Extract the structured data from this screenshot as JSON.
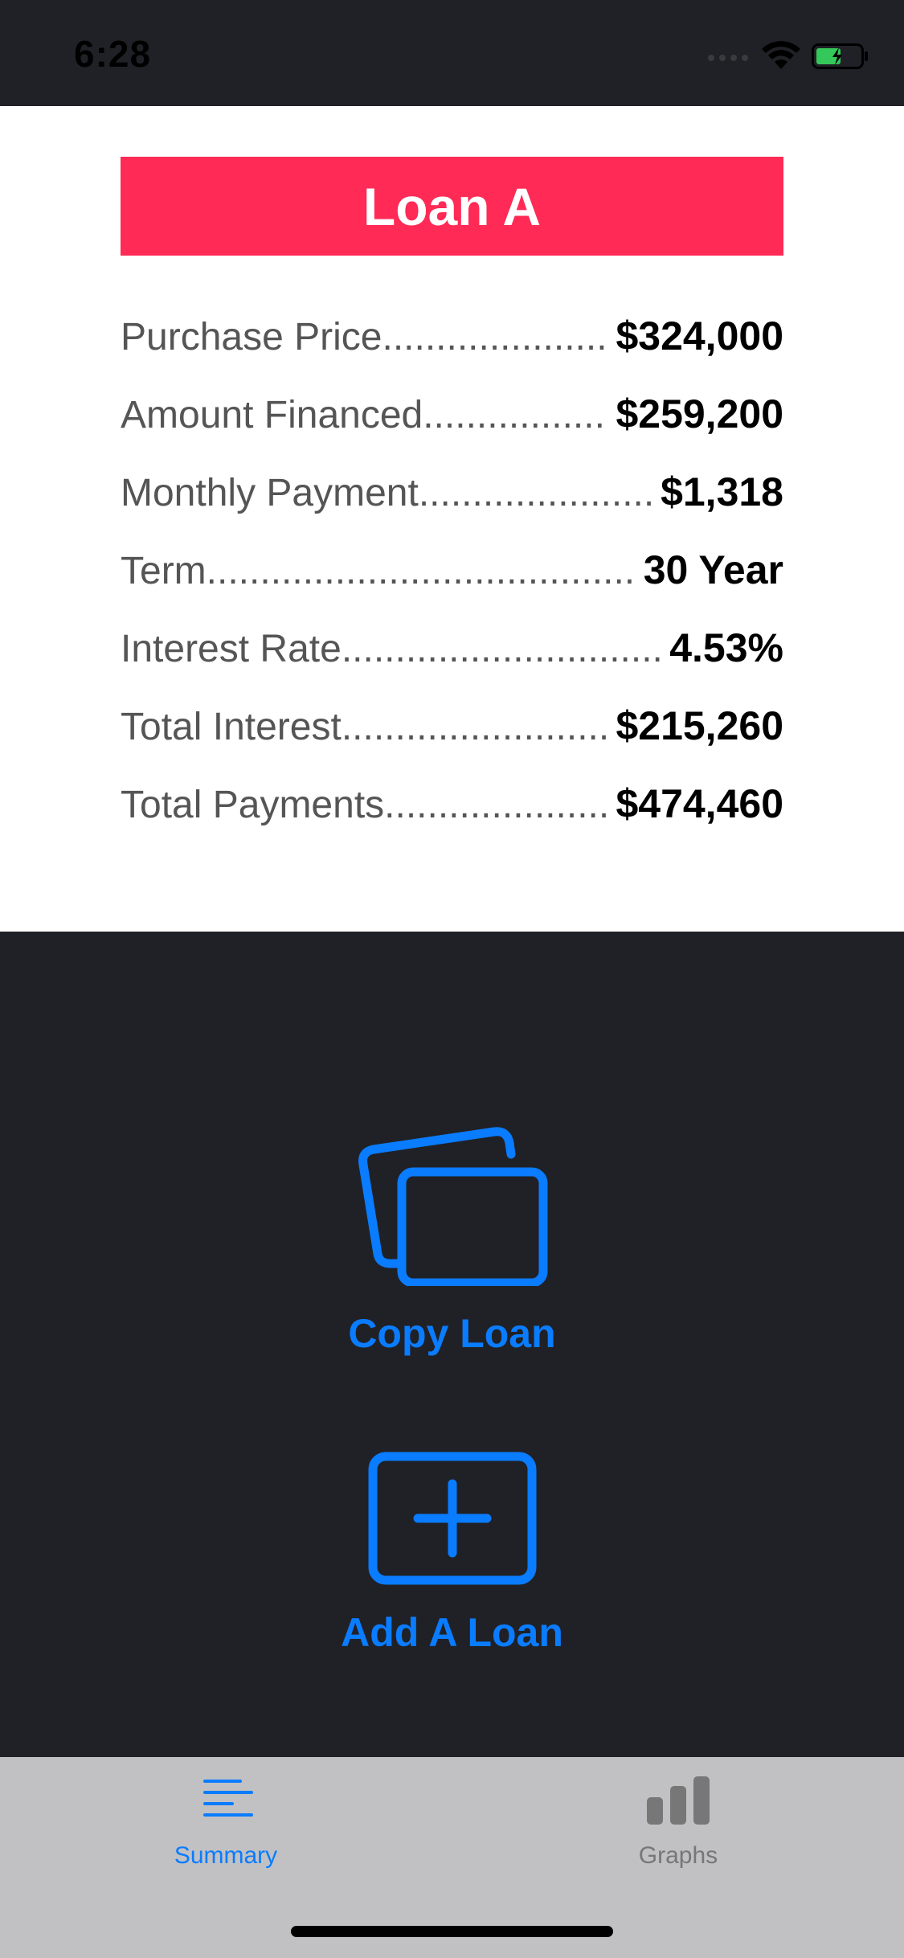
{
  "status_bar": {
    "time": "6:28",
    "icons": [
      "signal-dots-icon",
      "wifi-icon",
      "battery-charging-icon"
    ],
    "battery_color": "#34c759"
  },
  "loan": {
    "title": "Loan A",
    "title_color": "#ff2a55",
    "rows": [
      {
        "label": "Purchase Price",
        "value": "$324,000"
      },
      {
        "label": "Amount Financed",
        "value": "$259,200"
      },
      {
        "label": "Monthly Payment",
        "value": "$1,318"
      },
      {
        "label": "Term",
        "value": "30 Year"
      },
      {
        "label": "Interest Rate",
        "value": "4.53%"
      },
      {
        "label": "Total Interest",
        "value": "$215,260"
      },
      {
        "label": "Total Payments",
        "value": "$474,460"
      }
    ]
  },
  "actions": {
    "copy_label": "Copy Loan",
    "copy_icon": "copy-cards-icon",
    "add_label": "Add A Loan",
    "add_icon": "plus-square-icon",
    "accent_color": "#0a7cff"
  },
  "tab_bar": {
    "tabs": [
      {
        "label": "Summary",
        "icon": "text-align-left-icon",
        "selected": true
      },
      {
        "label": "Graphs",
        "icon": "bar-chart-icon",
        "selected": false
      }
    ]
  }
}
